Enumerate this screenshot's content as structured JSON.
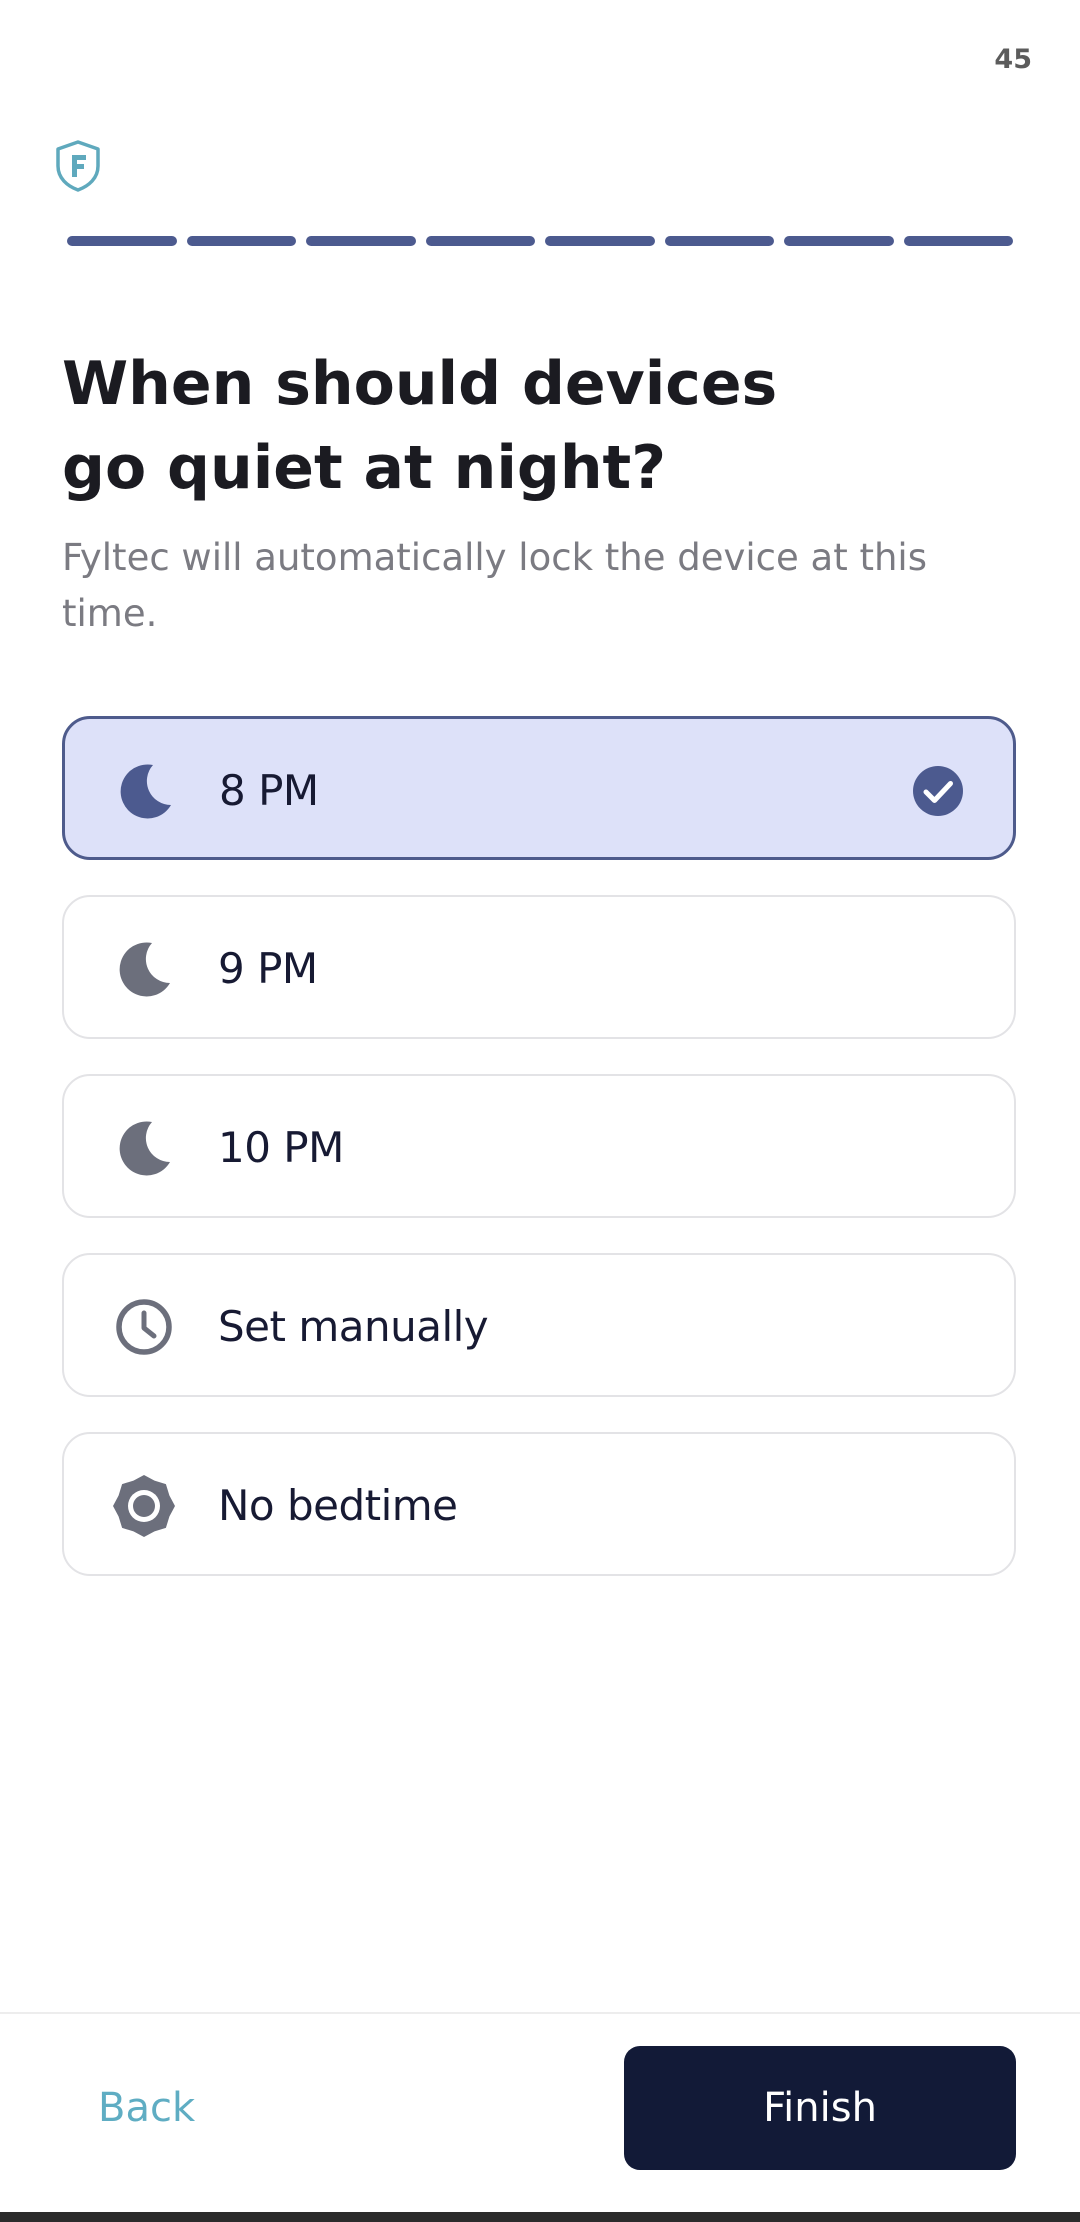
{
  "status_bar": {
    "text": "45"
  },
  "progress": {
    "total_steps": 8,
    "completed_steps": 8
  },
  "header": {
    "title_line1": "When should devices",
    "title_line2": "go quiet at night?",
    "subtitle": "Fyltec will automatically lock the device at this time."
  },
  "options": [
    {
      "label": "8 PM",
      "icon": "moon-icon",
      "selected": true
    },
    {
      "label": "9 PM",
      "icon": "moon-icon",
      "selected": false
    },
    {
      "label": "10 PM",
      "icon": "moon-icon",
      "selected": false
    },
    {
      "label": "Set manually",
      "icon": "clock-icon",
      "selected": false
    },
    {
      "label": "No bedtime",
      "icon": "sun-icon",
      "selected": false
    }
  ],
  "footer": {
    "back_label": "Back",
    "finish_label": "Finish"
  },
  "colors": {
    "accent": "#4c5a8f",
    "selected_bg": "#dde1f9",
    "primary_button": "#121a37",
    "link": "#5fadc3",
    "icon_gray": "#6c6f7c"
  }
}
